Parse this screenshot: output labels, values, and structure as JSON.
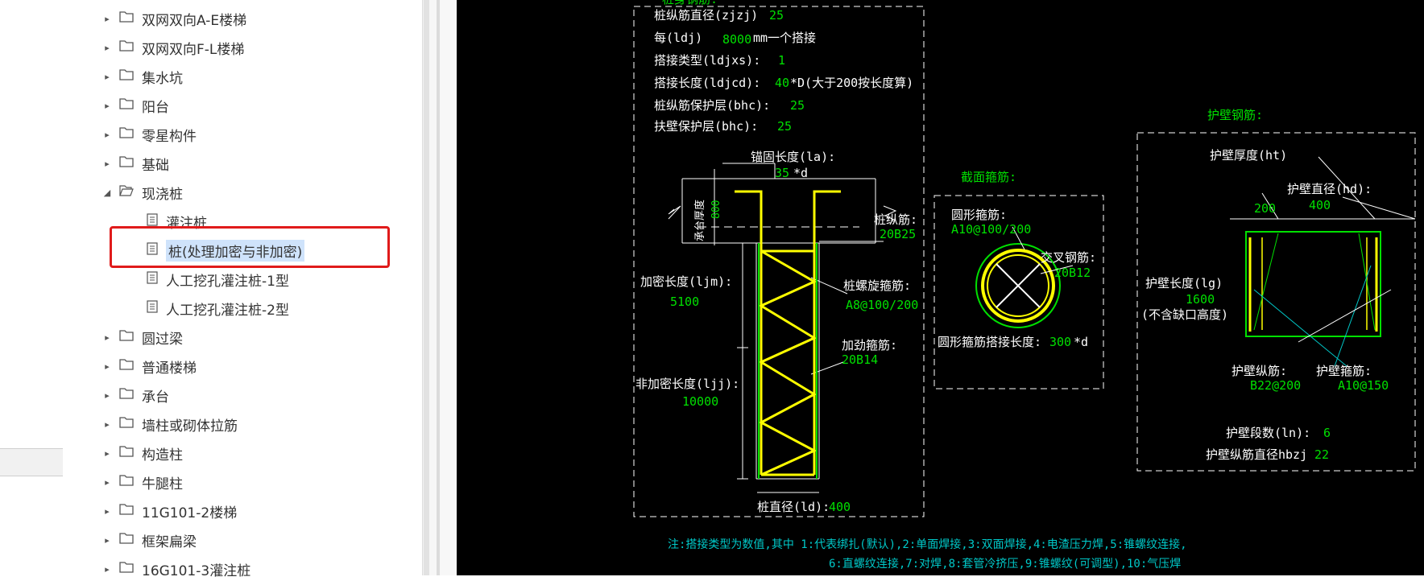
{
  "tree": {
    "items": [
      {
        "label": "双网双向A-E楼梯",
        "type": "folder",
        "expanded": false
      },
      {
        "label": "双网双向F-L楼梯",
        "type": "folder",
        "expanded": false
      },
      {
        "label": "集水坑",
        "type": "folder",
        "expanded": false
      },
      {
        "label": "阳台",
        "type": "folder",
        "expanded": false
      },
      {
        "label": "零星构件",
        "type": "folder",
        "expanded": false
      },
      {
        "label": "基础",
        "type": "folder",
        "expanded": false
      },
      {
        "label": "现浇桩",
        "type": "folder",
        "expanded": true
      },
      {
        "label": "灌注桩",
        "type": "doc"
      },
      {
        "label": "桩(处理加密与非加密)",
        "type": "doc",
        "selected": true
      },
      {
        "label": "人工挖孔灌注桩-1型",
        "type": "doc"
      },
      {
        "label": "人工挖孔灌注桩-2型",
        "type": "doc"
      },
      {
        "label": "圆过梁",
        "type": "folder",
        "expanded": false
      },
      {
        "label": "普通楼梯",
        "type": "folder",
        "expanded": false
      },
      {
        "label": "承台",
        "type": "folder",
        "expanded": false
      },
      {
        "label": "墙柱或砌体拉筋",
        "type": "folder",
        "expanded": false
      },
      {
        "label": "构造柱",
        "type": "folder",
        "expanded": false
      },
      {
        "label": "牛腿柱",
        "type": "folder",
        "expanded": false
      },
      {
        "label": "11G101-2楼梯",
        "type": "folder",
        "expanded": false
      },
      {
        "label": "框架扁梁",
        "type": "folder",
        "expanded": false
      },
      {
        "label": "16G101-3灌注桩",
        "type": "folder",
        "expanded": false
      }
    ]
  },
  "drawing": {
    "top_title": "桩身钢筋:",
    "pile_params": {
      "zjzj_label": "桩纵筋直径(zjzj)",
      "zjzj_value": "25",
      "ldj_label": "每(ldj)",
      "ldj_value": "8000",
      "ldj_suffix": "mm一个搭接",
      "ldjxs_label": "搭接类型(ldjxs):",
      "ldjxs_value": "1",
      "ldjcd_label": "搭接长度(ldjcd):",
      "ldjcd_value": "40",
      "ldjcd_suffix": "*D(大于200按长度算)",
      "bhc_label": "桩纵筋保护层(bhc):",
      "bhc_value": "25",
      "fbhc_label": "扶壁保护层(bhc):",
      "fbhc_value": "25"
    },
    "pile": {
      "la_label": "锚固长度(la):",
      "la_value": "35",
      "la_suffix": "*d",
      "cap_label": "承台厚度",
      "cap_value": "800",
      "zjj_label": "桩纵筋:",
      "zjj_value": "20B25",
      "ljm_label": "加密长度(ljm):",
      "ljm_value": "5100",
      "ljj_label": "非加密长度(ljj):",
      "ljj_value": "10000",
      "spiral_label": "桩螺旋箍筋:",
      "spiral_value": "A8@100/200",
      "stiff_label": "加劲箍筋:",
      "stiff_value": "20B14",
      "diam_label": "桩直径(ld):",
      "diam_value": "400"
    },
    "section": {
      "title": "截面箍筋:",
      "ring_label": "圆形箍筋:",
      "ring_value": "A10@100/200",
      "cross_label": "交叉钢筋:",
      "cross_value": "20B12",
      "lap_label": "圆形箍筋搭接长度:",
      "lap_value": "300",
      "lap_suffix": "*d"
    },
    "wall": {
      "title": "护壁钢筋:",
      "ht_label": "护壁厚度(ht)",
      "ht_value": "200",
      "hd_label": "护壁直径(hd):",
      "hd_value": "400",
      "lg_label": "护壁长度(lg)",
      "lg_value": "1600",
      "lg_note": "(不含缺口高度)",
      "long_label": "护壁纵筋:",
      "long_value": "B22@200",
      "hoop_label": "护壁箍筋:",
      "hoop_value": "A10@150",
      "ln_label": "护壁段数(ln):",
      "ln_value": "6",
      "hbzj_label": "护壁纵筋直径hbzj",
      "hbzj_value": "22"
    },
    "note_line1": "注:搭接类型为数值,其中 1:代表绑扎(默认),2:单面焊接,3:双面焊接,4:电渣压力焊,5:锥螺纹连接,",
    "note_line2": "6:直螺纹连接,7:对焊,8:套管冷挤压,9:锥螺纹(可调型),10:气压焊"
  },
  "colors": {
    "white": "#ffffff",
    "green": "#00e000",
    "yellow": "#ffff00",
    "cyan": "#00c8c8",
    "red": "#e01b1b",
    "select": "#cfe3fb"
  }
}
